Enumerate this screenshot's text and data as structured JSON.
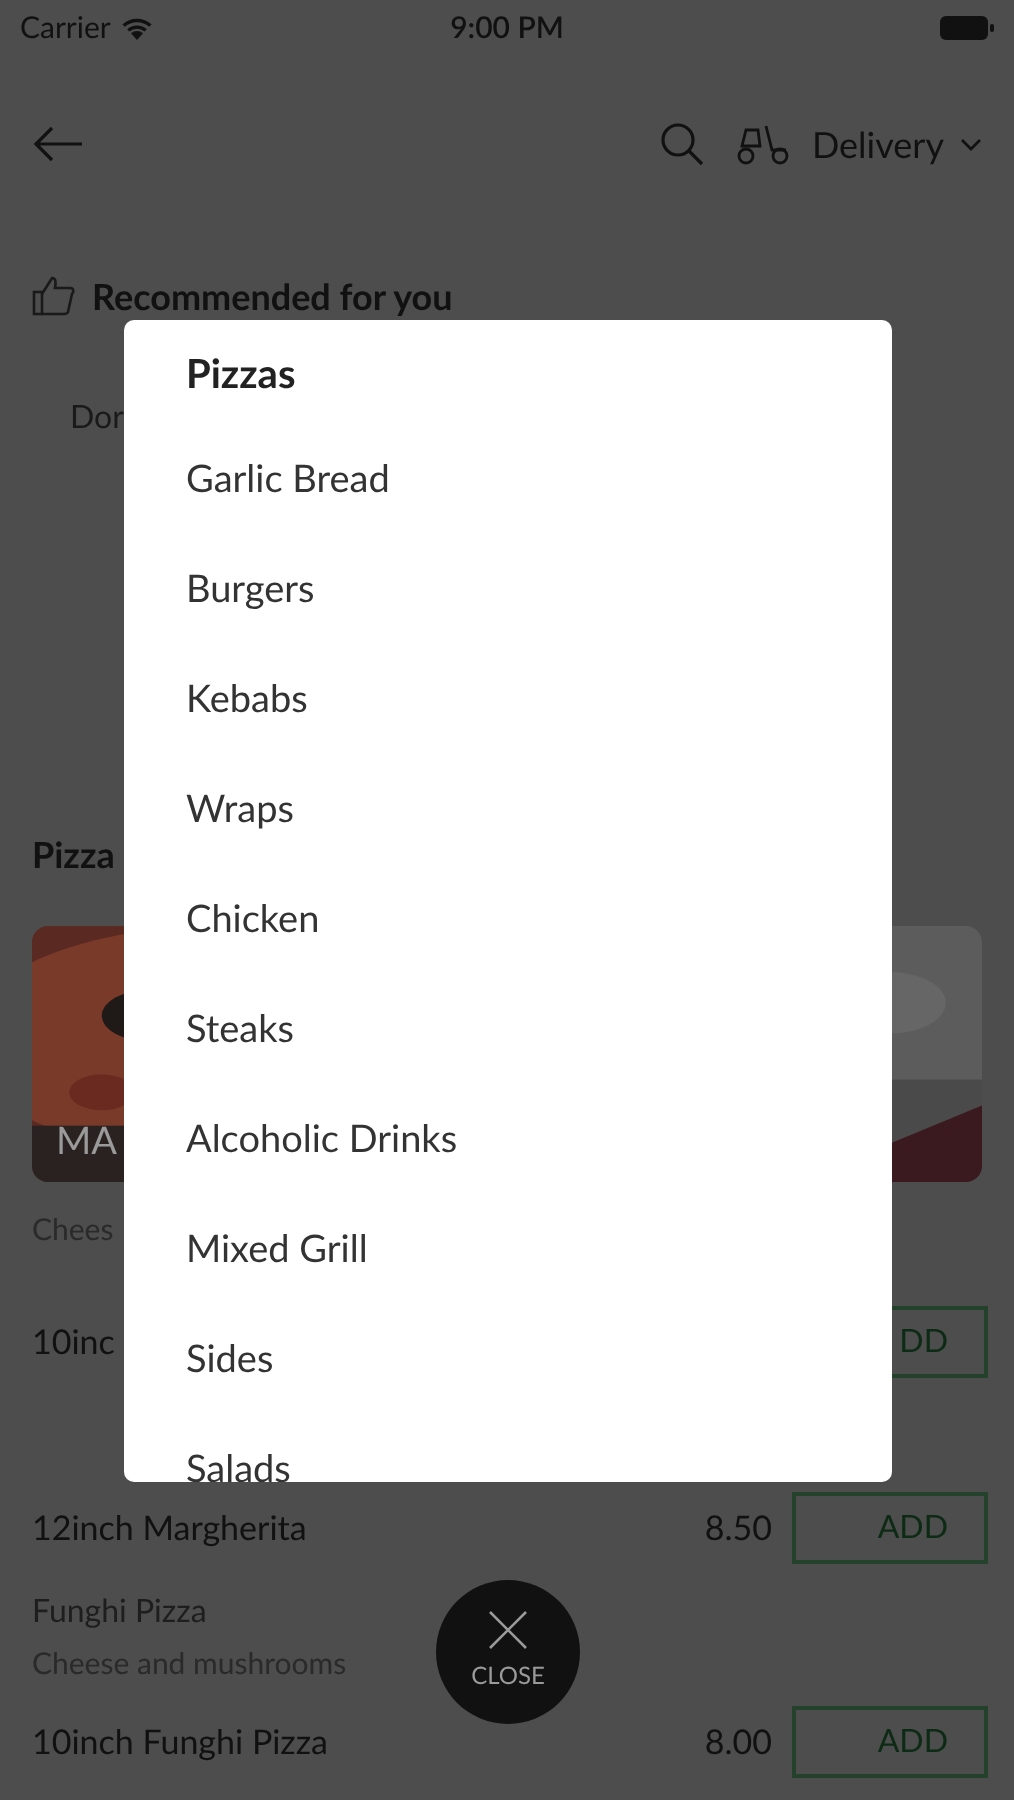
{
  "status_bar": {
    "carrier": "Carrier",
    "time": "9:00 PM"
  },
  "header": {
    "mode": "Delivery"
  },
  "recommended": {
    "title": "Recommended for you",
    "item": "Dor"
  },
  "section": {
    "title": "Pizza",
    "card_label": "MA",
    "card_description": "Chees"
  },
  "rows": [
    {
      "kind": "dish",
      "name": "10inc",
      "price": "",
      "button": "DD"
    },
    {
      "kind": "dish",
      "name": "12inch Margherita",
      "price": "8.50",
      "button": "ADD"
    },
    {
      "kind": "group",
      "name": "Funghi Pizza",
      "description": "Cheese and mushrooms"
    },
    {
      "kind": "dish",
      "name": "10inch Funghi Pizza",
      "price": "8.00",
      "button": "ADD"
    }
  ],
  "menu": {
    "title": "Pizzas",
    "items": [
      "Garlic Bread",
      "Burgers",
      "Kebabs",
      "Wraps",
      "Chicken",
      "Steaks",
      "Alcoholic Drinks",
      "Mixed Grill",
      "Sides",
      "Salads"
    ]
  },
  "close_button": {
    "label": "CLOSE"
  }
}
